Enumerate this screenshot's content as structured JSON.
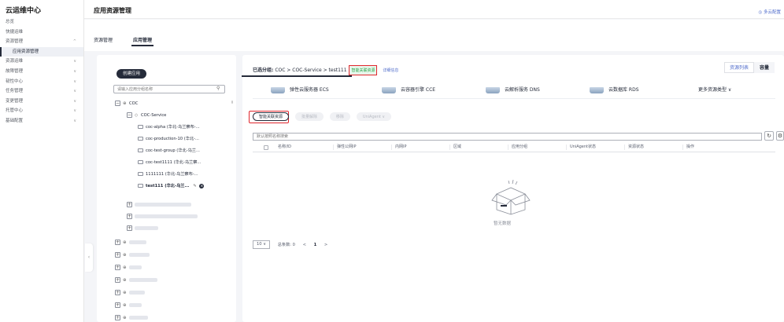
{
  "sidebar": {
    "title": "云运维中心",
    "items": [
      {
        "label": "总览",
        "chev": ""
      },
      {
        "label": "快捷运维",
        "chev": ""
      },
      {
        "label": "资源管理",
        "chev": "^"
      },
      {
        "label": "应用资源管理",
        "chev": ""
      },
      {
        "label": "资源运维",
        "chev": "∨"
      },
      {
        "label": "故障管理",
        "chev": "∨"
      },
      {
        "label": "韧性中心",
        "chev": "∨"
      },
      {
        "label": "任务管理",
        "chev": "∨"
      },
      {
        "label": "变更管理",
        "chev": "∨"
      },
      {
        "label": "托管中心",
        "chev": "∨"
      },
      {
        "label": "基础配置",
        "chev": "∨"
      }
    ]
  },
  "header": {
    "title": "应用资源管理",
    "right_link": "◎ 多云配置"
  },
  "main_tabs": [
    "资源管理",
    "应用管理"
  ],
  "tree": {
    "create_label": "创建应用",
    "search_placeholder": "请输入应用分组名称",
    "root": "COC",
    "child": "COC-Service",
    "leaves": [
      "coc-alpha (华北-乌兰察布-...",
      "coc-production-10 (华北-...",
      "coc-test-group (华北-乌兰...",
      "coc-test1111 (华北-乌兰察...",
      "1111111 (华北-乌兰察布-...",
      "test111 (华北-乌兰..."
    ]
  },
  "content": {
    "selected_label": "已选分组:",
    "selected_path": "COC > COC-Service > test111",
    "smart_link": "智能关联资源",
    "detail_link": "详细信息",
    "view_buttons": [
      "资源列表",
      "容量"
    ],
    "resource_tabs": [
      "弹性云服务器 ECS",
      "云容器引擎 CCE",
      "云解析服务 DNS",
      "云数据库 RDS"
    ],
    "more_types": "更多资源类型 ∨",
    "op_buttons": [
      "智能关联资源",
      "批量解除",
      "移除",
      "UniAgent ∨"
    ],
    "search_placeholder": "默认按照名称搜索",
    "columns": [
      "名称/ID",
      "弹性公网IP",
      "内网IP",
      "区域",
      "应用分组",
      "UniAgent状态",
      "资源状态",
      "操作"
    ],
    "empty_text": "暂无数据",
    "pager": {
      "page_size": "10 ∨",
      "total": "总条数: 0",
      "prev": "<",
      "current": "1",
      "next": ">"
    }
  }
}
